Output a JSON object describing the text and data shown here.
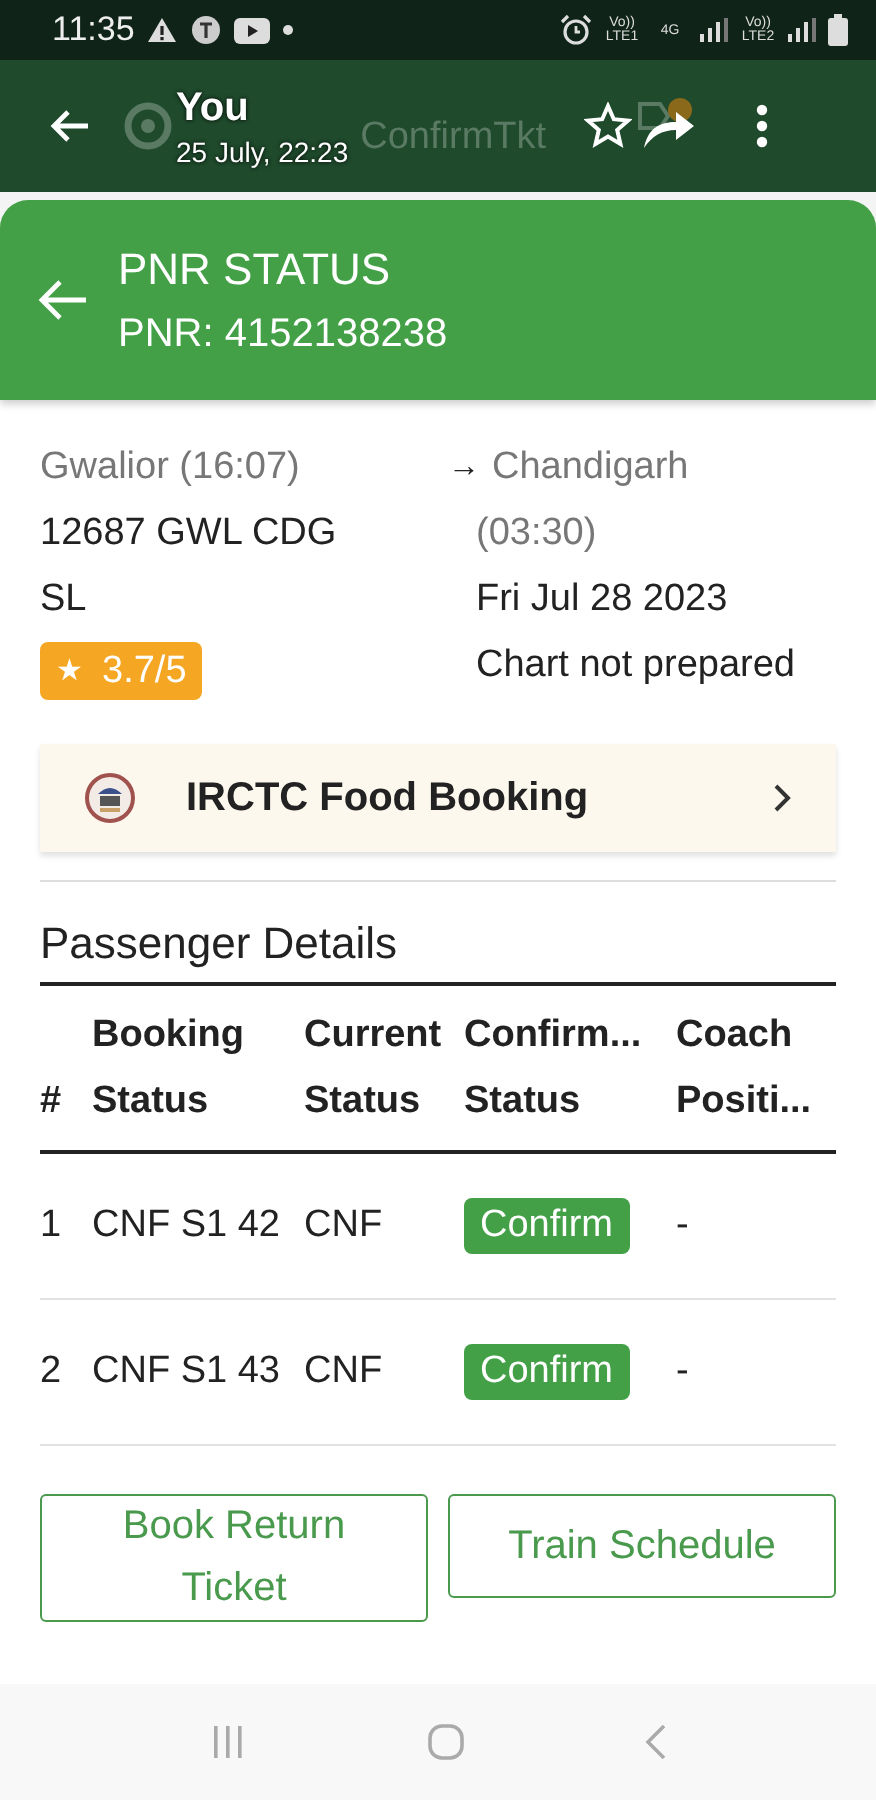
{
  "status_bar": {
    "time": "11:35",
    "indicators": [
      "Vo)) LTE1",
      "4G",
      "Vo)) LTE2"
    ]
  },
  "viewer_bar": {
    "sender": "You",
    "timestamp": "25 July, 22:23",
    "background_title": "ConfirmTkt",
    "starred": false
  },
  "header": {
    "title": "PNR STATUS",
    "pnr": "PNR: 4152138238"
  },
  "journey": {
    "from": "Gwalior (16:07)",
    "train": "12687 GWL CDG",
    "class": "SL",
    "rating_icon": "★",
    "rating": "3.7/5",
    "arrow": "→",
    "to": "Chandigarh",
    "arrival": "(03:30)",
    "date": "Fri Jul 28 2023",
    "chart": "Chart not prepared"
  },
  "food_banner": {
    "label": "IRCTC Food Booking"
  },
  "passengers": {
    "title": "Passenger Details",
    "columns": [
      {
        "line2": "#"
      },
      {
        "line1": "Booking",
        "line2": "Status"
      },
      {
        "line1": "Current",
        "line2": "Status"
      },
      {
        "line1": "Confirm...",
        "line2": "Status"
      },
      {
        "line1": "Coach",
        "line2": "Positi..."
      }
    ],
    "rows": [
      {
        "cells": [
          {
            "kind": "text",
            "text": "1"
          },
          {
            "kind": "text",
            "text": "CNF S1 42"
          },
          {
            "kind": "text",
            "text": "CNF"
          },
          {
            "kind": "chip",
            "text": "Confirm"
          },
          {
            "kind": "text",
            "text": "-"
          }
        ]
      },
      {
        "cells": [
          {
            "kind": "text",
            "text": "2"
          },
          {
            "kind": "text",
            "text": "CNF S1 43"
          },
          {
            "kind": "text",
            "text": "CNF"
          },
          {
            "kind": "chip",
            "text": "Confirm"
          },
          {
            "kind": "text",
            "text": "-"
          }
        ]
      }
    ]
  },
  "buttons": [
    "Book Return Ticket",
    "Train Schedule"
  ]
}
